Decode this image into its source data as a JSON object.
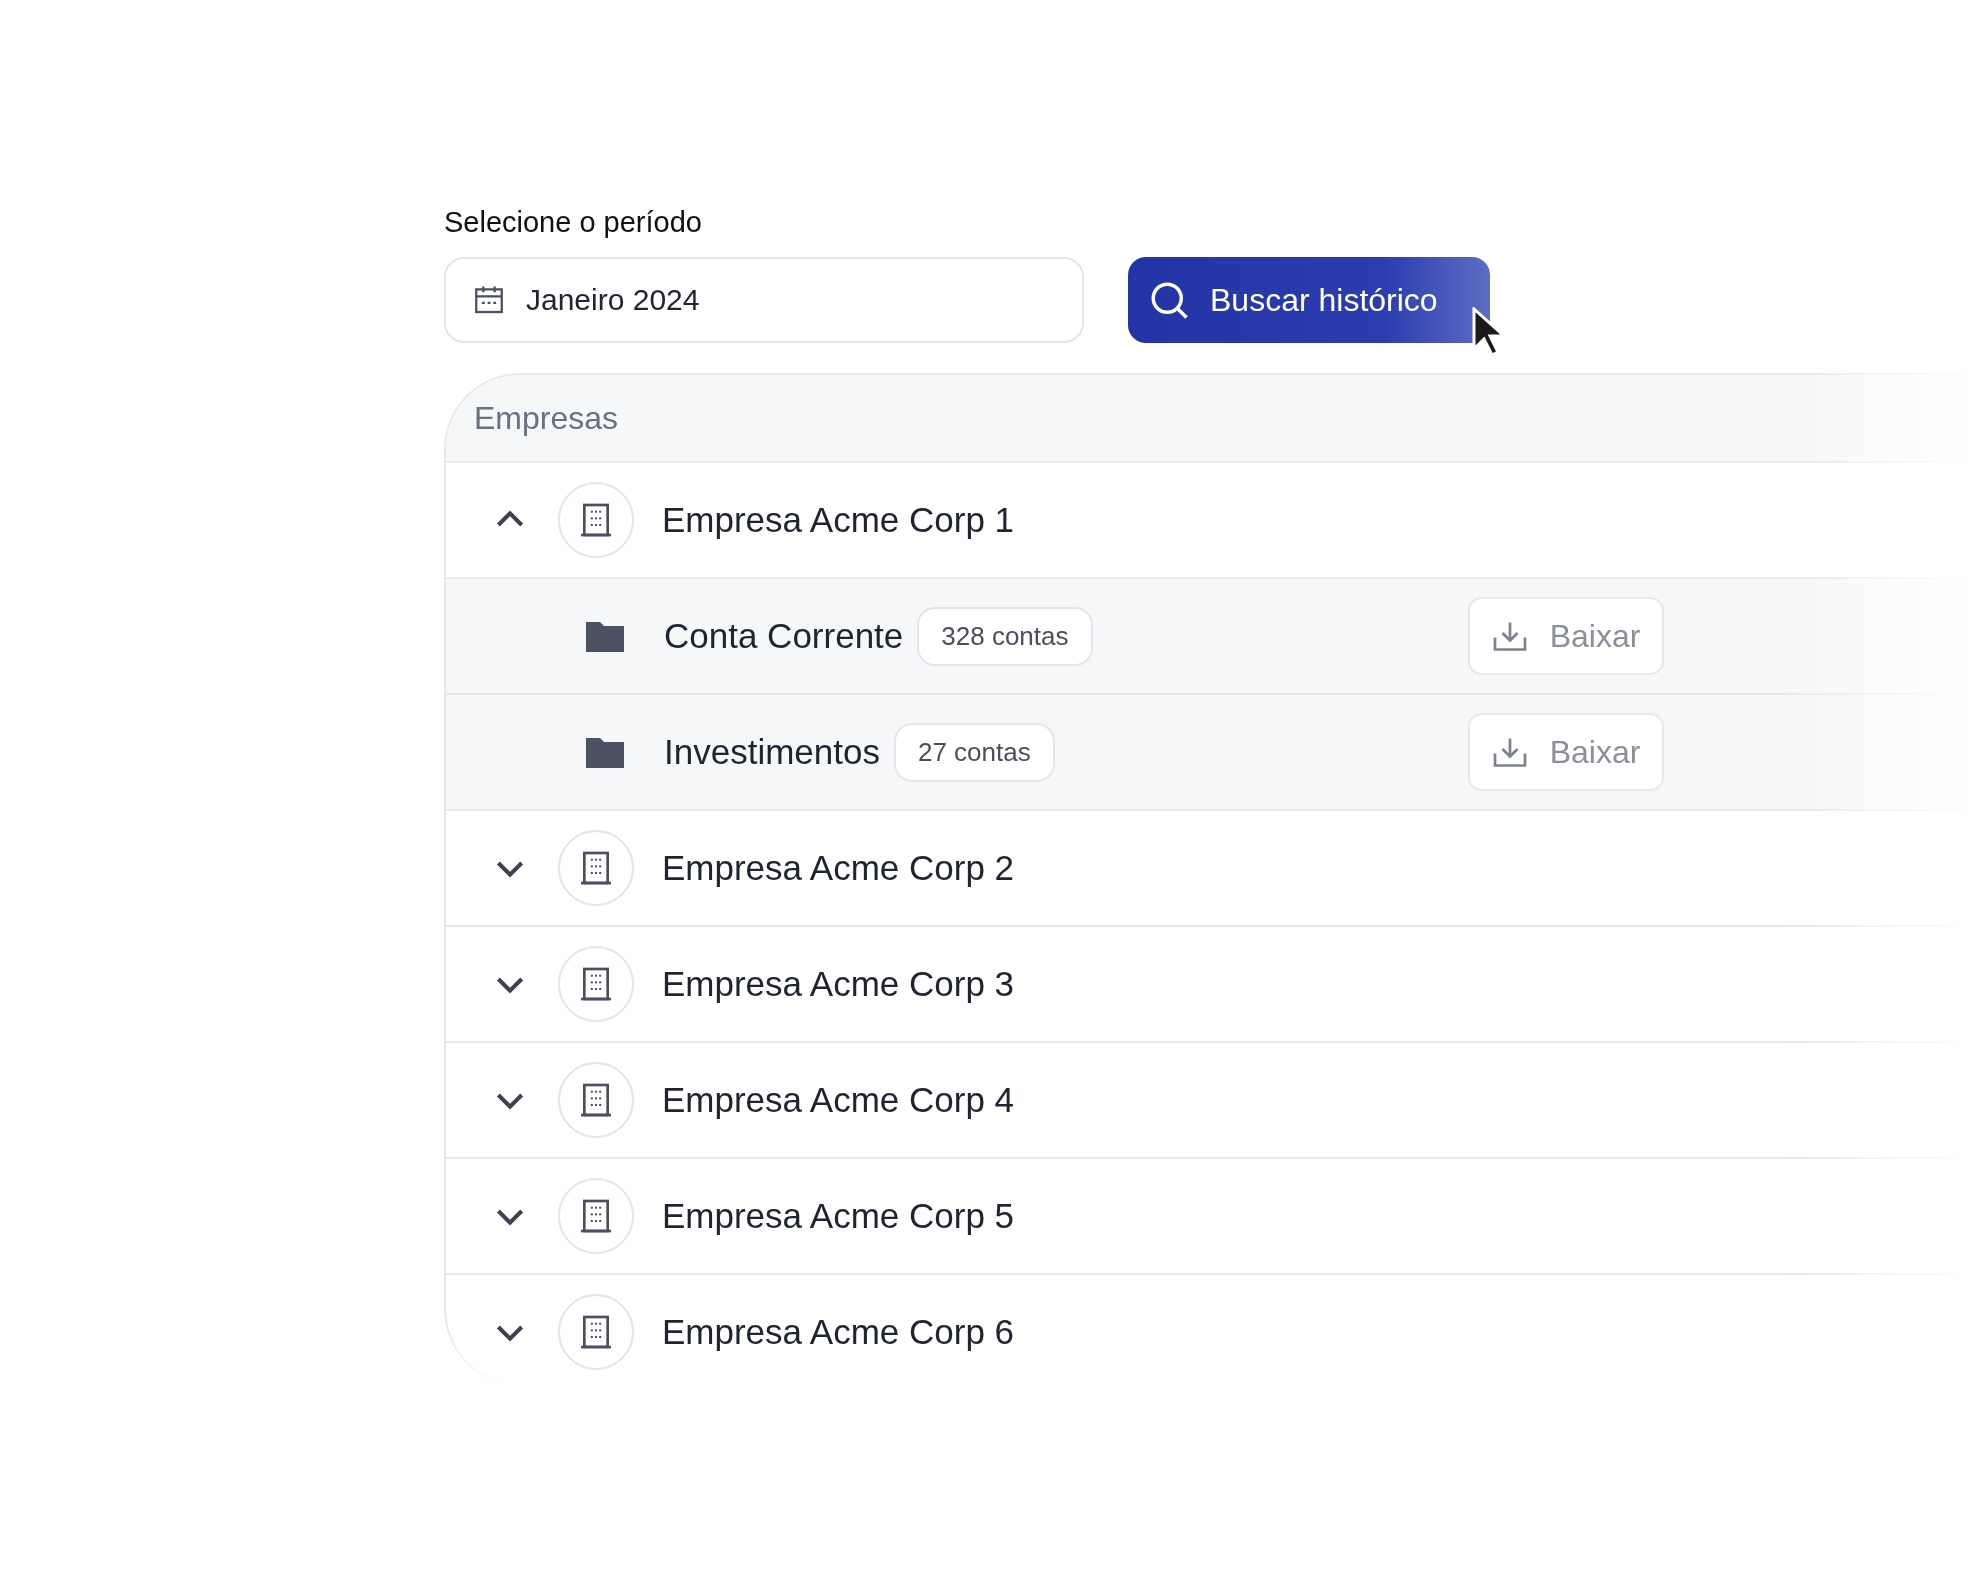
{
  "period": {
    "label": "Selecione o período",
    "value": "Janeiro 2024"
  },
  "search_button": {
    "label": "Buscar histórico"
  },
  "table": {
    "header": "Empresas",
    "companies": [
      {
        "name": "Empresa Acme Corp 1",
        "expanded": true,
        "children": [
          {
            "name": "Conta Corrente",
            "badge": "328 contas",
            "action": "Baixar"
          },
          {
            "name": "Investimentos",
            "badge": "27 contas",
            "action": "Baixar"
          }
        ]
      },
      {
        "name": "Empresa Acme Corp 2",
        "expanded": false
      },
      {
        "name": "Empresa Acme Corp 3",
        "expanded": false
      },
      {
        "name": "Empresa Acme Corp 4",
        "expanded": false
      },
      {
        "name": "Empresa Acme Corp 5",
        "expanded": false
      },
      {
        "name": "Empresa Acme Corp 6",
        "expanded": false
      }
    ]
  }
}
